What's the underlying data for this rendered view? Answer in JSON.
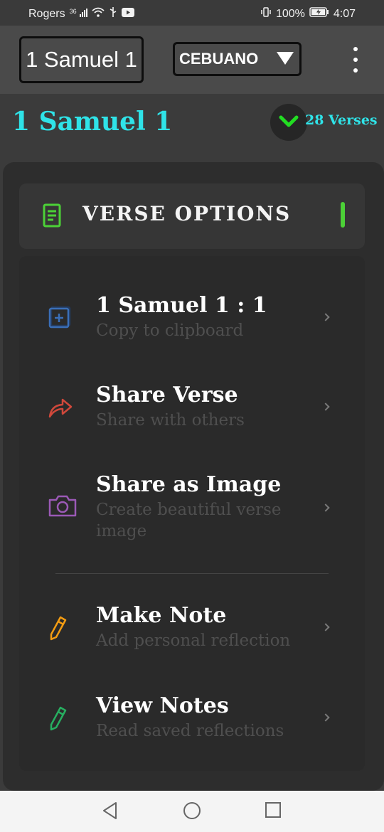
{
  "status_bar": {
    "carrier": "Rogers",
    "network": "36",
    "battery": "100%",
    "time": "4:07"
  },
  "header": {
    "book_selector": "1 Samuel 1",
    "language_selector": "CEBUANO"
  },
  "chapter": {
    "title": "1 Samuel 1",
    "verse_count": "28 Verses"
  },
  "verse_options": {
    "title": "VERSE OPTIONS",
    "items": [
      {
        "title": "1 Samuel 1 : 1",
        "subtitle": "Copy to clipboard",
        "icon": "copy-icon"
      },
      {
        "title": "Share Verse",
        "subtitle": "Share with others",
        "icon": "share-arrow-icon"
      },
      {
        "title": "Share as Image",
        "subtitle": "Create beautiful verse image",
        "icon": "camera-icon"
      },
      {
        "title": "Make Note",
        "subtitle": "Add personal reflection",
        "icon": "pencil-icon"
      },
      {
        "title": "View Notes",
        "subtitle": "Read saved reflections",
        "icon": "pencil-icon"
      }
    ]
  },
  "colors": {
    "accent_cyan": "#2fe3e8",
    "accent_green": "#4cd137",
    "copy_icon": "#3a6fb8",
    "share_icon": "#d0483b",
    "camera_icon": "#9b59b6",
    "note_icon": "#f39c12",
    "view_icon": "#27ae60"
  }
}
